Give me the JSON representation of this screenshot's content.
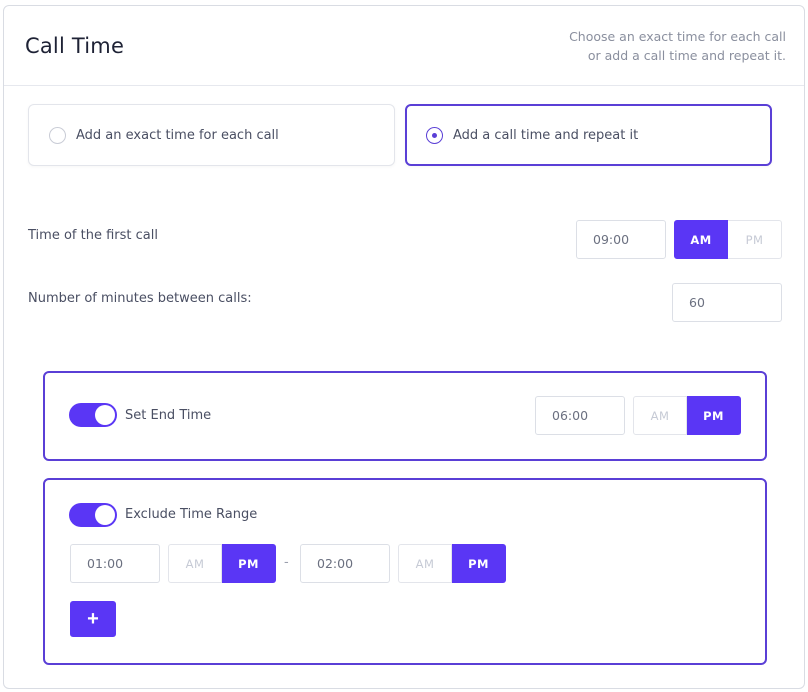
{
  "header": {
    "title": "Call Time",
    "description_line1": "Choose an exact time for each call",
    "description_line2": "or add a call time and repeat it."
  },
  "options": [
    {
      "label": "Add an exact time for each call",
      "selected": false
    },
    {
      "label": "Add a call time and repeat it",
      "selected": true
    }
  ],
  "first_call": {
    "label": "Time of the first call",
    "time": "09:00",
    "am_label": "AM",
    "pm_label": "PM",
    "period": "AM"
  },
  "interval": {
    "label": "Number of minutes between calls:",
    "value": "60"
  },
  "end_time": {
    "toggle_label": "Set End Time",
    "enabled": true,
    "time": "06:00",
    "am_label": "AM",
    "pm_label": "PM",
    "period": "PM"
  },
  "exclude_range": {
    "toggle_label": "Exclude Time Range",
    "enabled": true,
    "from_time": "01:00",
    "from_period": "PM",
    "separator": "-",
    "to_time": "02:00",
    "to_period": "PM",
    "am_label": "AM",
    "pm_label": "PM",
    "add_label": "+"
  },
  "colors": {
    "accent": "#5a36f5",
    "selected_border": "#5a3fd6"
  }
}
